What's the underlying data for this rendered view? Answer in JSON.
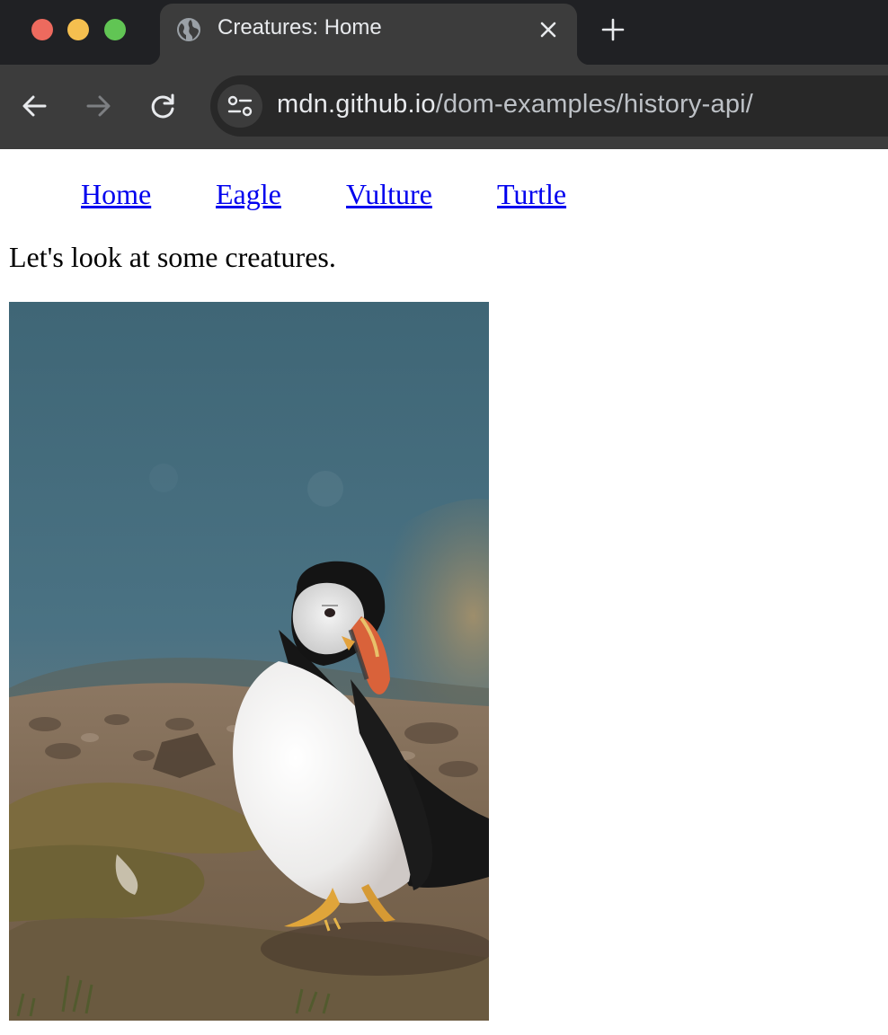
{
  "browser": {
    "tab": {
      "title": "Creatures: Home",
      "favicon": "globe-icon"
    },
    "window_controls": [
      "close",
      "minimize",
      "maximize"
    ],
    "address_bar": {
      "host": "mdn.github.io",
      "path": "/dom-examples/history-api/"
    }
  },
  "page": {
    "nav": [
      {
        "label": "Home"
      },
      {
        "label": "Eagle"
      },
      {
        "label": "Vulture"
      },
      {
        "label": "Turtle"
      }
    ],
    "intro": "Let's look at some creatures.",
    "image": {
      "subject": "puffin-photo"
    }
  },
  "colors": {
    "tabbar": "#202124",
    "toolbar": "#3c3c3c",
    "link": "#0000ee"
  }
}
